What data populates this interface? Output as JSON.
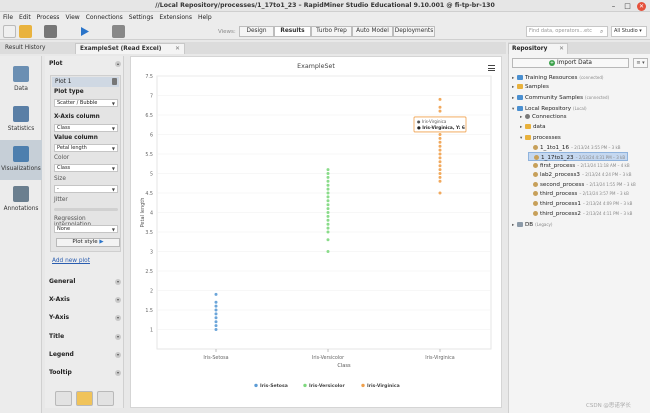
{
  "window": {
    "title": "//Local Repository/processes/1_17to1_23 – RapidMiner Studio Educational 9.10.001 @ fi-tp-br-130",
    "minimize": "–",
    "maximize": "□",
    "close": "✕"
  },
  "menu": [
    "File",
    "Edit",
    "Process",
    "View",
    "Connections",
    "Settings",
    "Extensions",
    "Help"
  ],
  "toolbar": {
    "views_label": "Views:",
    "views": [
      "Design",
      "Results",
      "Turbo Prep",
      "Auto Model",
      "Deployments"
    ],
    "active_view": "Results",
    "search_placeholder": "Find data, operators...etc",
    "studio_label": "All Studio ▾"
  },
  "left_tabs": {
    "result_history": "Result History",
    "example_set": "ExampleSet (Read Excel)",
    "close": "✕"
  },
  "left_nav": [
    "Data",
    "Statistics",
    "Visualizations",
    "Annotations"
  ],
  "plot_panel": {
    "section_plot": "Plot",
    "plot_name": "Plot 1",
    "plot_type_label": "Plot type",
    "plot_type_value": "Scatter / Bubble",
    "x_axis_label": "X-Axis column",
    "x_axis_value": "Class",
    "value_label": "Value column",
    "value_value": "Petal length",
    "color_label": "Color",
    "color_value": "Class",
    "size_label": "Size",
    "size_value": "-",
    "jitter_label": "Jitter",
    "regression_label": "Regression interpolation",
    "regression_value": "None",
    "plot_style_label": "Plot style",
    "new_plot": "Add new plot",
    "sections": [
      "General",
      "X-Axis",
      "Y-Axis",
      "Title",
      "Legend",
      "Tooltip"
    ]
  },
  "repository": {
    "tab": "Repository",
    "close": "✕",
    "import_label": "Import Data",
    "items": [
      {
        "label": "Training Resources",
        "sub": "(connected)",
        "icon": "repo",
        "indent": 0,
        "exp": "▸"
      },
      {
        "label": "Samples",
        "sub": "",
        "icon": "folder",
        "indent": 0,
        "exp": "▸"
      },
      {
        "label": "Community Samples",
        "sub": "(connected)",
        "icon": "repo",
        "indent": 0,
        "exp": "▸"
      },
      {
        "label": "Local Repository",
        "sub": "(Local)",
        "icon": "repo",
        "indent": 0,
        "exp": "▾"
      },
      {
        "label": "Connections",
        "sub": "",
        "icon": "conn",
        "indent": 1,
        "exp": "▸"
      },
      {
        "label": "data",
        "sub": "",
        "icon": "folder",
        "indent": 1,
        "exp": "▸"
      },
      {
        "label": "processes",
        "sub": "",
        "icon": "folder",
        "indent": 1,
        "exp": "▾"
      },
      {
        "label": "1_1to1_16",
        "sub": "– 2/13/24 3:55 PM – 3 kB",
        "icon": "proc",
        "indent": 2,
        "exp": ""
      },
      {
        "label": "1_17to1_23",
        "sub": "– 2/13/24 4:31 PM – 3 kB",
        "icon": "proc",
        "indent": 2,
        "exp": "",
        "selected": true
      },
      {
        "label": "first_process",
        "sub": "– 2/13/24 11:18 AM – 4 kB",
        "icon": "proc",
        "indent": 2,
        "exp": ""
      },
      {
        "label": "lab2_process3",
        "sub": "– 2/13/24 4:24 PM – 3 kB",
        "icon": "proc",
        "indent": 2,
        "exp": ""
      },
      {
        "label": "second_process",
        "sub": "– 2/13/24 1:55 PM – 3 kB",
        "icon": "proc",
        "indent": 2,
        "exp": ""
      },
      {
        "label": "third_process",
        "sub": "– 2/13/24 3:57 PM – 3 kB",
        "icon": "proc",
        "indent": 2,
        "exp": ""
      },
      {
        "label": "third_process1",
        "sub": "– 2/13/24 4:09 PM – 3 kB",
        "icon": "proc",
        "indent": 2,
        "exp": ""
      },
      {
        "label": "third_process2",
        "sub": "– 2/13/24 4:11 PM – 3 kB",
        "icon": "proc",
        "indent": 2,
        "exp": ""
      },
      {
        "label": "DB",
        "sub": "(Legacy)",
        "icon": "db",
        "indent": 0,
        "exp": "▸"
      }
    ]
  },
  "watermark": "CSDN @思诺学长",
  "colors": {
    "setosa": "#5b9bd5",
    "versicolor": "#7dd87d",
    "virginica": "#f0a04b"
  },
  "chart_data": {
    "type": "scatter",
    "title": "ExampleSet",
    "xlabel": "Class",
    "ylabel": "Petal length",
    "categories": [
      "Iris-Setosa",
      "Iris-Versicolor",
      "Iris-Virginica"
    ],
    "ylim": [
      0.5,
      7.5
    ],
    "yticks": [
      1,
      1.5,
      2,
      2.5,
      3,
      3.5,
      4,
      4.5,
      5,
      5.5,
      6,
      6.5,
      7,
      7.5
    ],
    "series": [
      {
        "name": "Iris-Setosa",
        "category": "Iris-Setosa",
        "values": [
          1.0,
          1.1,
          1.2,
          1.3,
          1.4,
          1.5,
          1.6,
          1.7,
          1.9
        ]
      },
      {
        "name": "Iris-Versicolor",
        "category": "Iris-Versicolor",
        "values": [
          3.0,
          3.3,
          3.5,
          3.6,
          3.7,
          3.8,
          3.9,
          4.0,
          4.1,
          4.2,
          4.3,
          4.4,
          4.5,
          4.6,
          4.7,
          4.8,
          4.9,
          5.0,
          5.1
        ]
      },
      {
        "name": "Iris-Virginica",
        "category": "Iris-Virginica",
        "values": [
          4.5,
          4.8,
          4.9,
          5.0,
          5.1,
          5.2,
          5.3,
          5.4,
          5.5,
          5.6,
          5.7,
          5.8,
          5.9,
          6.0,
          6.1,
          6.3,
          6.4,
          6.6,
          6.7,
          6.9
        ]
      }
    ],
    "tooltip": {
      "title": "Iris-Virginica",
      "text": "Iris-Virginica, Y: 6"
    },
    "legend": "bottom-center",
    "grid": true
  }
}
